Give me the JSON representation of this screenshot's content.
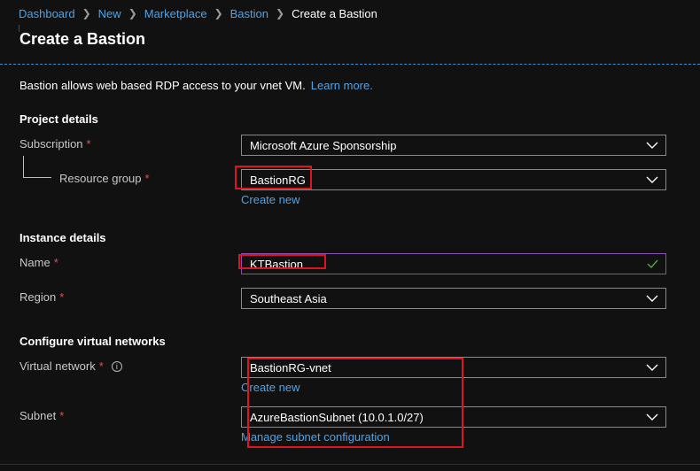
{
  "breadcrumb": {
    "items": [
      "Dashboard",
      "New",
      "Marketplace",
      "Bastion"
    ],
    "current": "Create a Bastion"
  },
  "page": {
    "title": "Create a Bastion"
  },
  "intro": {
    "text": "Bastion allows web based RDP access to your vnet VM.",
    "learn_more": "Learn more."
  },
  "sections": {
    "project": "Project details",
    "instance": "Instance details",
    "network": "Configure virtual networks"
  },
  "fields": {
    "subscription": {
      "label": "Subscription",
      "required": "*",
      "value": "Microsoft Azure Sponsorship"
    },
    "resource_group": {
      "label": "Resource group",
      "required": "*",
      "value": "BastionRG",
      "create_new": "Create new"
    },
    "name": {
      "label": "Name",
      "required": "*",
      "value": "KTBastion",
      "valid_icon": "checkmark-icon"
    },
    "region": {
      "label": "Region",
      "required": "*",
      "value": "Southeast Asia"
    },
    "virtual_network": {
      "label": "Virtual network",
      "required": "*",
      "info_icon": "info-icon",
      "value": "BastionRG-vnet",
      "create_new": "Create new"
    },
    "subnet": {
      "label": "Subnet",
      "required": "*",
      "value": "AzureBastionSubnet (10.0.1.0/27)",
      "manage": "Manage subnet configuration"
    }
  },
  "colors": {
    "background": "#111111",
    "link": "#4fa3e8",
    "required": "#e0534f",
    "input_border": "#8a8a8a",
    "focus_border": "#8b4fb8",
    "valid_check": "#57a64a",
    "highlight": "#e0141e"
  }
}
